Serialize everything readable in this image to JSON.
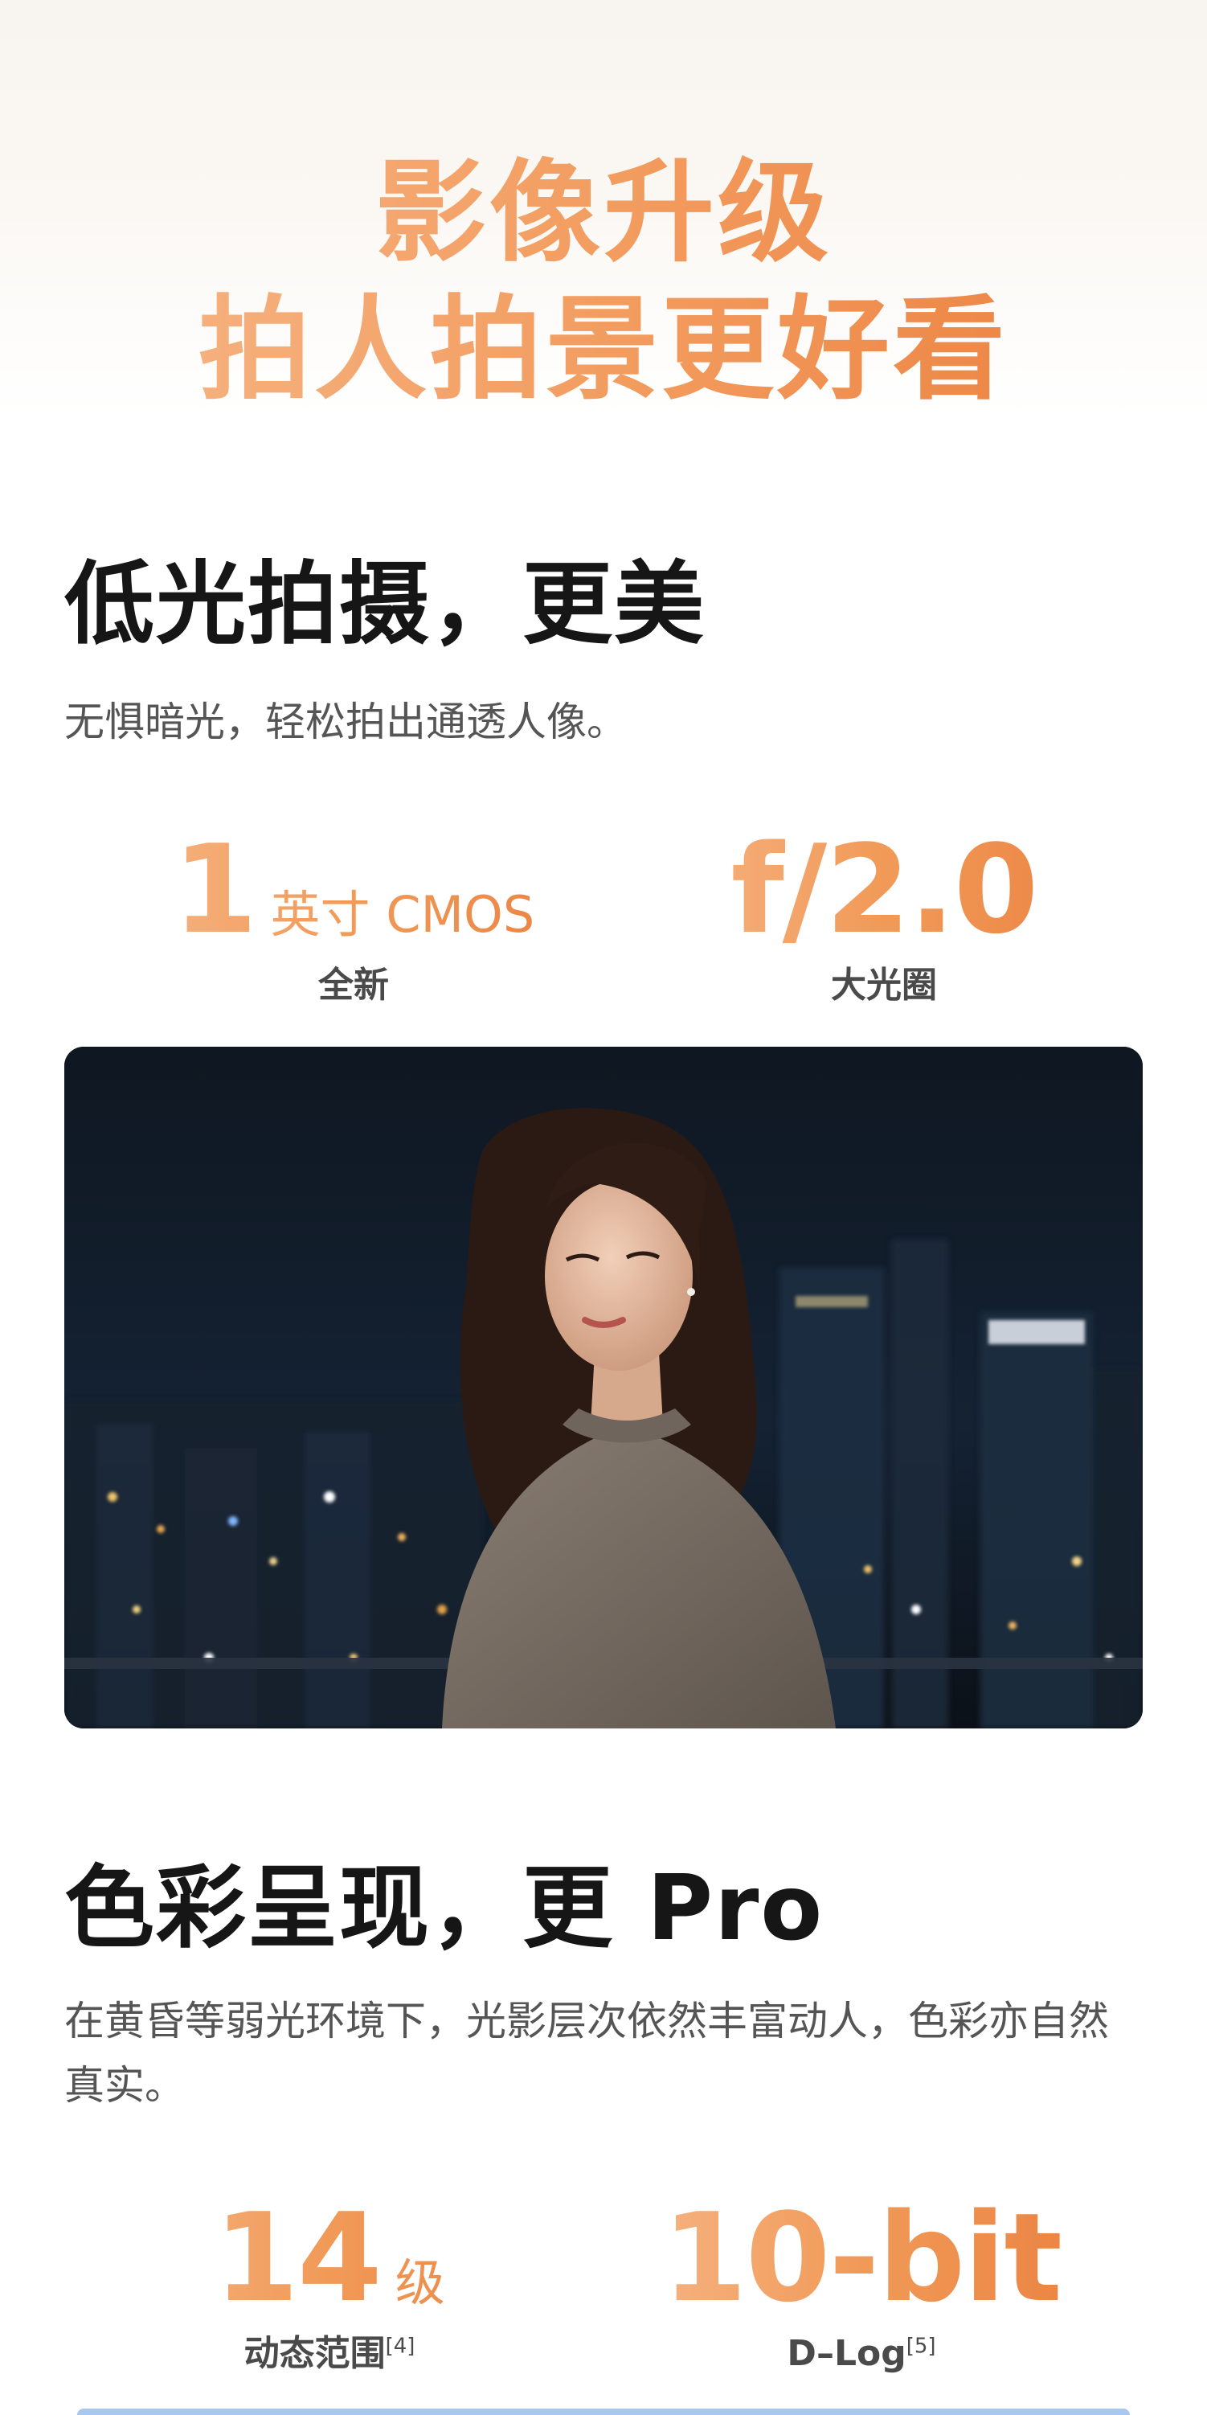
{
  "hero": {
    "line1": "影像升级",
    "line2": "拍人拍景更好看"
  },
  "section_low_light": {
    "heading": "低光拍摄，更美",
    "description": "无惧暗光，轻松拍出通透人像。",
    "stats": [
      {
        "value": "1",
        "unit": "英寸 CMOS",
        "label": "全新"
      },
      {
        "value": "f/2.0",
        "unit": "",
        "label": "大光圈"
      }
    ]
  },
  "photo": {
    "subject": "woman-night-city-portrait"
  },
  "section_color": {
    "heading": "色彩呈现，更 Pro",
    "description": "在黄昏等弱光环境下，光影层次依然丰富动人，色彩亦自然真实。",
    "stats": [
      {
        "value": "14",
        "unit": "级",
        "label": "动态范围",
        "footnote": "[4]"
      },
      {
        "value": "10-bit",
        "unit": "",
        "label": "D–Log",
        "footnote": "[5]"
      }
    ]
  },
  "colors": {
    "accent_orange": "#ee8c48",
    "accent_light": "#f7b88a",
    "heading_text": "#161616",
    "body_text": "#555555",
    "bottom_strip": "#a9c8ee"
  }
}
